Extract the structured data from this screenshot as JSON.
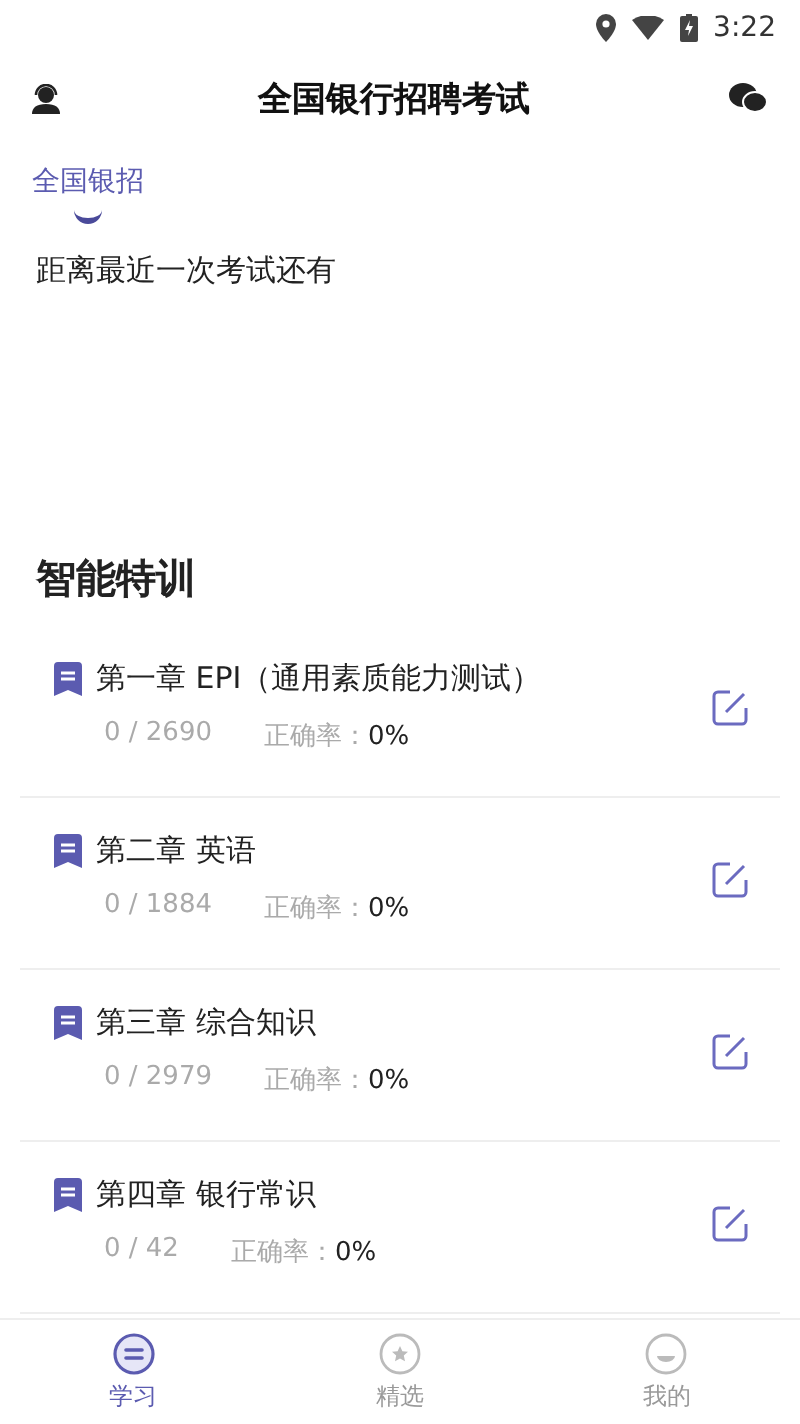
{
  "status_bar": {
    "time": "3:22"
  },
  "header": {
    "title": "全国银行招聘考试"
  },
  "tabs": [
    {
      "label": "全国银招",
      "selected": true
    }
  ],
  "countdown": {
    "text": "距离最近一次考试还有"
  },
  "section": {
    "title": "智能特训"
  },
  "chapters": [
    {
      "title": "第一章 EPI（通用素质能力测试）",
      "progress": "0 / 2690",
      "accuracy_label": "正确率：",
      "accuracy": "0%"
    },
    {
      "title": "第二章 英语",
      "progress": "0 / 1884",
      "accuracy_label": "正确率：",
      "accuracy": "0%"
    },
    {
      "title": "第三章 综合知识",
      "progress": "0 / 2979",
      "accuracy_label": "正确率：",
      "accuracy": "0%"
    },
    {
      "title": "第四章 银行常识",
      "progress": "0 / 42",
      "accuracy_label": "正确率：",
      "accuracy": "0%"
    }
  ],
  "bottom_nav": [
    {
      "label": "学习",
      "kind": "study",
      "selected": true
    },
    {
      "label": "精选",
      "kind": "featured",
      "selected": false
    },
    {
      "label": "我的",
      "kind": "profile",
      "selected": false
    }
  ]
}
